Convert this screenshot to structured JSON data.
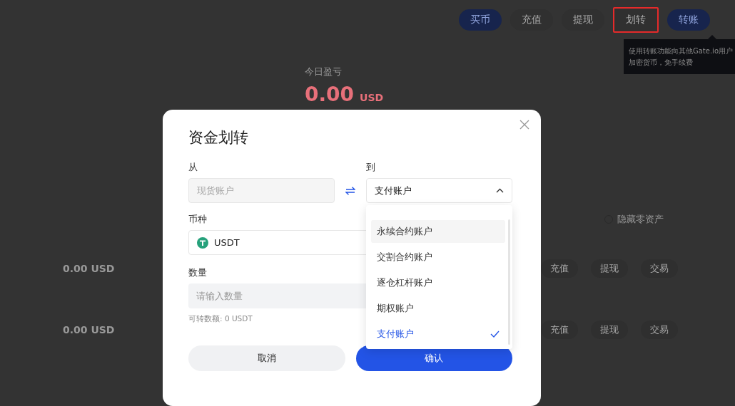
{
  "top_actions": [
    {
      "label": "买币",
      "kind": "primary",
      "highlighted": false
    },
    {
      "label": "充值",
      "kind": "plain",
      "highlighted": false
    },
    {
      "label": "提现",
      "kind": "plain",
      "highlighted": false
    },
    {
      "label": "划转",
      "kind": "plain",
      "highlighted": true
    },
    {
      "label": "转账",
      "kind": "primary",
      "highlighted": false
    }
  ],
  "tooltip": {
    "lines": [
      "使用转账功能向其他Gate.io用户",
      "加密货币，免手续费"
    ]
  },
  "today_pnl": {
    "label": "今日盈亏",
    "value": "0.00",
    "unit": "USD"
  },
  "hide_zero": {
    "label": "隐藏零资产",
    "checked": false
  },
  "asset_rows": [
    {
      "total": "0.00 USD",
      "actions": [
        "充值",
        "提现",
        "交易"
      ]
    },
    {
      "total": "0.00 USD",
      "actions": [
        "充值",
        "提现",
        "交易"
      ]
    }
  ],
  "dialog": {
    "title": "资金划转",
    "from": {
      "label": "从",
      "value": "现货账户",
      "disabled": true
    },
    "to": {
      "label": "到",
      "value": "支付账户",
      "expanded": true
    },
    "currency": {
      "label": "币种",
      "value": "USDT"
    },
    "amount": {
      "label": "数量",
      "placeholder": "请输入数量",
      "hint": "可转数额: 0 USDT"
    },
    "options": [
      {
        "label": "永续合约账户",
        "hovered": true,
        "selected": false
      },
      {
        "label": "交割合约账户",
        "hovered": false,
        "selected": false
      },
      {
        "label": "逐仓杠杆账户",
        "hovered": false,
        "selected": false
      },
      {
        "label": "期权账户",
        "hovered": false,
        "selected": false
      },
      {
        "label": "支付账户",
        "hovered": false,
        "selected": true
      }
    ],
    "buttons": [
      {
        "label": "取消",
        "kind": "secondary"
      },
      {
        "label": "确认",
        "kind": "primary"
      }
    ]
  }
}
